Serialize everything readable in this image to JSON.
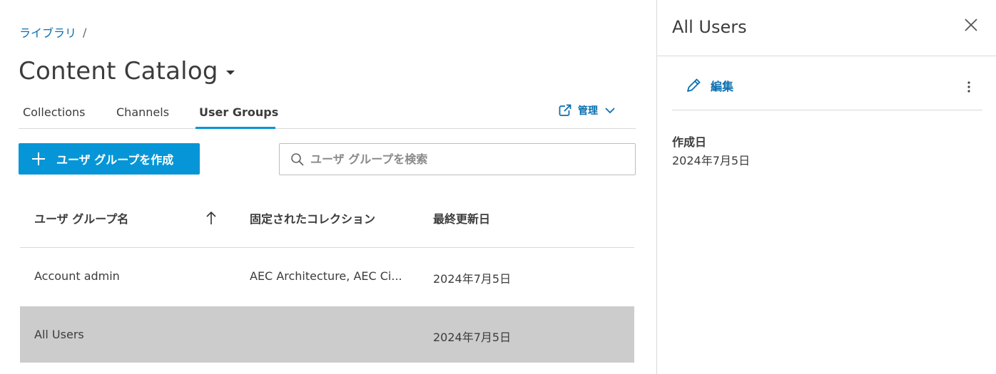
{
  "breadcrumb": {
    "link": "ライブラリ",
    "separator": "/"
  },
  "page": {
    "title": "Content Catalog"
  },
  "tabs": [
    {
      "label": "Collections"
    },
    {
      "label": "Channels"
    },
    {
      "label": "User Groups",
      "active": true
    }
  ],
  "manage": {
    "label": "管理"
  },
  "toolbar": {
    "create_label": "ユーザ グループを作成",
    "search_placeholder": "ユーザ グループを検索"
  },
  "table": {
    "columns": [
      "ユーザ グループ名",
      "固定されたコレクション",
      "最終更新日"
    ],
    "sort": "ascending",
    "rows": [
      {
        "name": "Account admin",
        "collections": "AEC Architecture, AEC Ci...",
        "updated": "2024年7月5日",
        "selected": false
      },
      {
        "name": "All Users",
        "collections": "",
        "updated": "2024年7月5日",
        "selected": true
      }
    ]
  },
  "panel": {
    "title": "All Users",
    "edit_label": "編集",
    "created_label": "作成日",
    "created_value": "2024年7月5日"
  },
  "colors": {
    "accent": "#0696d7",
    "link": "#0a6fb0",
    "selected_row": "#cccccc",
    "border": "#d9d9d9"
  }
}
